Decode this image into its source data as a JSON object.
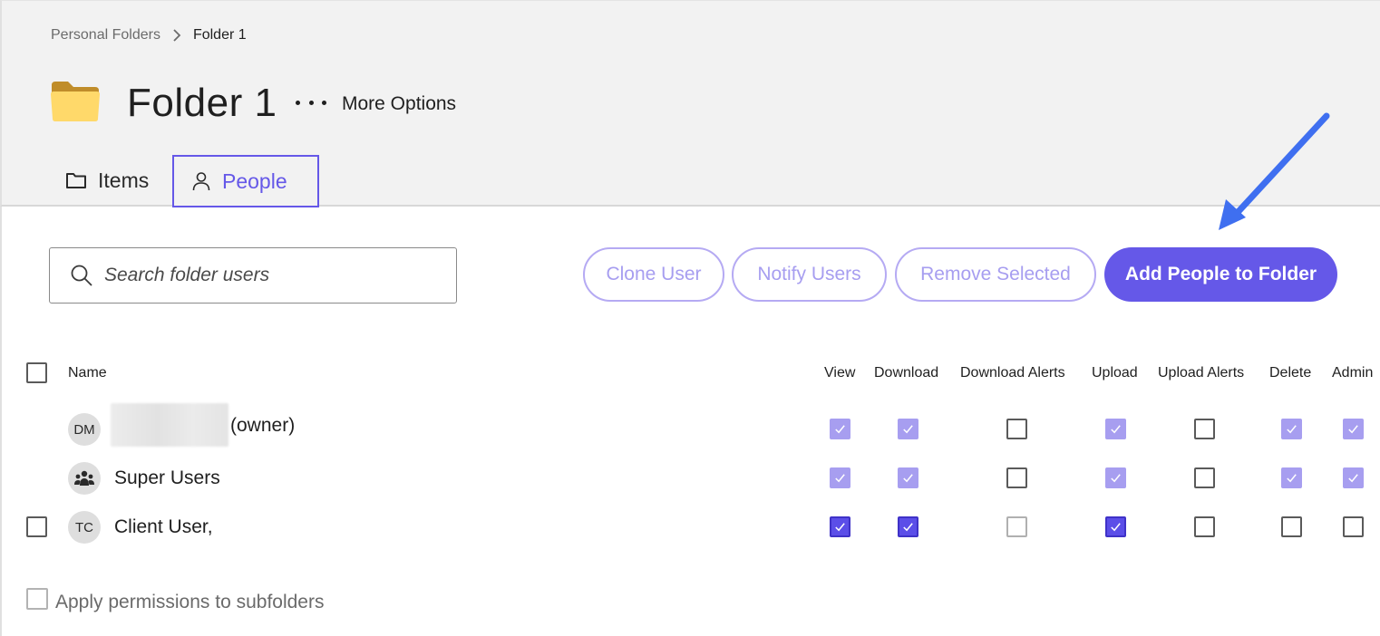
{
  "breadcrumb": {
    "parent": "Personal Folders",
    "current": "Folder 1"
  },
  "folder": {
    "title": "Folder 1",
    "more_options": "More Options",
    "icon": "folder-icon"
  },
  "tabs": [
    {
      "label": "Items",
      "icon": "folder-outline-icon",
      "active": false
    },
    {
      "label": "People",
      "icon": "person-icon",
      "active": true
    }
  ],
  "search": {
    "placeholder": "Search folder users",
    "value": ""
  },
  "actions": {
    "clone": "Clone User",
    "notify": "Notify Users",
    "remove": "Remove Selected",
    "add": "Add People to Folder"
  },
  "table": {
    "columns": [
      "Name",
      "View",
      "Download",
      "Download Alerts",
      "Upload",
      "Upload Alerts",
      "Delete",
      "Admin"
    ],
    "rows": [
      {
        "initials": "DM",
        "name": "(owner)",
        "name_redacted": true,
        "selectable": false,
        "perms": [
          "checked-light",
          "checked-light",
          "unchecked",
          "checked-light",
          "unchecked",
          "checked-light",
          "checked-light"
        ]
      },
      {
        "initials": "",
        "icon": "group-users-icon",
        "name": "Super Users",
        "selectable": false,
        "perms": [
          "checked-light",
          "checked-light",
          "unchecked",
          "checked-light",
          "unchecked",
          "checked-light",
          "checked-light"
        ]
      },
      {
        "initials": "TC",
        "name": "Client User,",
        "selectable": true,
        "perms": [
          "checked-dark",
          "checked-dark",
          "disabled",
          "checked-dark",
          "unchecked",
          "unchecked",
          "unchecked"
        ]
      }
    ]
  },
  "apply_subfolders": "Apply permissions to subfolders",
  "colors": {
    "accent": "#6558e8",
    "accent_light": "#a79ef0",
    "header_bg": "#f2f2f2",
    "annotation_arrow": "#3f6ff0"
  }
}
